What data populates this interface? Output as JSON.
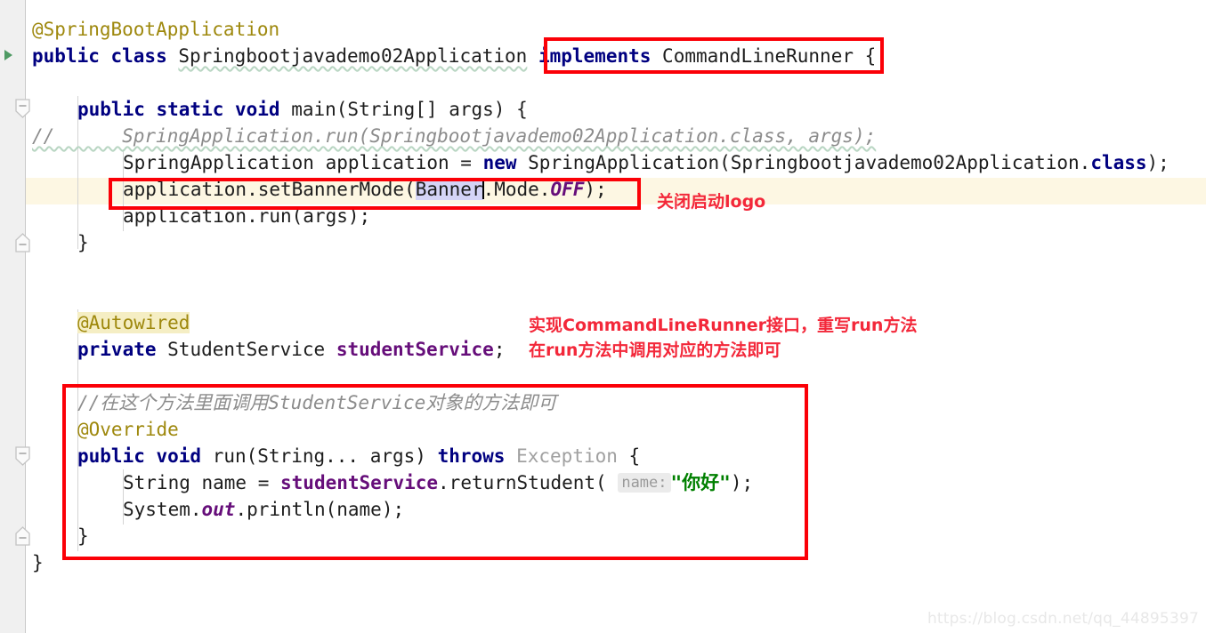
{
  "editor": {
    "kind": "intellij-java-editor",
    "language": "Java",
    "theme_background": "#ffffff",
    "current_line_highlight_color": "#fdf7e3",
    "selection_color": "#d4d4f7",
    "annotation_box_color": "#fb0007",
    "annotation_text_color": "#f3283a"
  },
  "code_lines": [
    {
      "n": 1,
      "indent": 0,
      "text": "@SpringBootApplication",
      "tokens": [
        {
          "t": "@SpringBootApplication",
          "c": "anno"
        }
      ]
    },
    {
      "n": 2,
      "indent": 0,
      "text": "public class Springbootjavademo02Application implements CommandLineRunner {",
      "tokens": [
        {
          "t": "public class ",
          "c": "kw"
        },
        {
          "t": "Springbootjavademo02Application",
          "c": "plain-underline"
        },
        {
          "t": " ",
          "c": "plain"
        },
        {
          "t": "implements ",
          "c": "kw"
        },
        {
          "t": "CommandLineRunner",
          "c": "plain"
        },
        {
          "t": " {",
          "c": "plain"
        }
      ]
    },
    {
      "n": 3,
      "indent": 1,
      "text": "public static void main(String[] args) {",
      "tokens": [
        {
          "t": "public static void ",
          "c": "kw"
        },
        {
          "t": "main(String[] args) {",
          "c": "plain"
        }
      ]
    },
    {
      "n": 4,
      "indent": 0,
      "text": "//      SpringApplication.run(Springbootjavademo02Application.class, args);",
      "tokens": [
        {
          "t": "//      SpringApplication.run(Springbootjavademo02Application.class, args);",
          "c": "comment"
        }
      ]
    },
    {
      "n": 5,
      "indent": 2,
      "text": "SpringApplication application = new SpringApplication(Springbootjavademo02Application.class);",
      "tokens": [
        {
          "t": "SpringApplication application = ",
          "c": "plain"
        },
        {
          "t": "new ",
          "c": "kw"
        },
        {
          "t": "SpringApplication(Springbootjavademo02Application.",
          "c": "plain"
        },
        {
          "t": "class",
          "c": "kw"
        },
        {
          "t": ");",
          "c": "plain"
        }
      ]
    },
    {
      "n": 6,
      "indent": 2,
      "text": "application.setBannerMode(Banner.Mode.OFF);",
      "selected_word": "Banner",
      "tokens": [
        {
          "t": "application.setBannerMode(",
          "c": "plain"
        },
        {
          "t": "Banner",
          "c": "sel"
        },
        {
          "t": ".Mode.",
          "c": "plain"
        },
        {
          "t": "OFF",
          "c": "statconst"
        },
        {
          "t": ");",
          "c": "plain"
        }
      ]
    },
    {
      "n": 7,
      "indent": 2,
      "text": "application.run(args);",
      "tokens": [
        {
          "t": "application.run(args);",
          "c": "plain"
        }
      ]
    },
    {
      "n": 8,
      "indent": 1,
      "text": "}",
      "tokens": [
        {
          "t": "}",
          "c": "plain"
        }
      ]
    },
    {
      "n": 9,
      "indent": 1,
      "text": "@Autowired",
      "tokens": [
        {
          "t": "@Autowired",
          "c": "anno-hl"
        }
      ]
    },
    {
      "n": 10,
      "indent": 1,
      "text": "private StudentService studentService;",
      "tokens": [
        {
          "t": "private ",
          "c": "kw"
        },
        {
          "t": "StudentService ",
          "c": "plain"
        },
        {
          "t": "studentService",
          "c": "field"
        },
        {
          "t": ";",
          "c": "plain"
        }
      ]
    },
    {
      "n": 11,
      "indent": 1,
      "text": "//在这个方法里面调用StudentService对象的方法即可",
      "tokens": [
        {
          "t": "//在这个方法里面调用StudentService对象的方法即可",
          "c": "comment"
        }
      ]
    },
    {
      "n": 12,
      "indent": 1,
      "text": "@Override",
      "tokens": [
        {
          "t": "@Override",
          "c": "anno"
        }
      ]
    },
    {
      "n": 13,
      "indent": 1,
      "text": "public void run(String... args) throws Exception {",
      "tokens": [
        {
          "t": "public void ",
          "c": "kw"
        },
        {
          "t": "run(String... args) ",
          "c": "plain"
        },
        {
          "t": "throws ",
          "c": "kw"
        },
        {
          "t": "Exception",
          "c": "grayed"
        },
        {
          "t": " {",
          "c": "plain"
        }
      ]
    },
    {
      "n": 14,
      "indent": 2,
      "text": "String name = studentService.returnStudent( name: \"你好\");",
      "param_hint": "name:",
      "tokens": [
        {
          "t": "String name = ",
          "c": "plain"
        },
        {
          "t": "studentService",
          "c": "field"
        },
        {
          "t": ".returnStudent( ",
          "c": "plain"
        },
        {
          "t": "name:",
          "c": "param-hint"
        },
        {
          "t": "\"你好\"",
          "c": "str"
        },
        {
          "t": ");",
          "c": "plain"
        }
      ]
    },
    {
      "n": 15,
      "indent": 2,
      "text": "System.out.println(name);",
      "tokens": [
        {
          "t": "System.",
          "c": "plain"
        },
        {
          "t": "out",
          "c": "statfield"
        },
        {
          "t": ".println(name);",
          "c": "plain"
        }
      ]
    },
    {
      "n": 16,
      "indent": 1,
      "text": "}",
      "tokens": [
        {
          "t": "}",
          "c": "plain"
        }
      ]
    },
    {
      "n": 17,
      "indent": 0,
      "text": "}",
      "tokens": [
        {
          "t": "}",
          "c": "plain"
        }
      ]
    }
  ],
  "lines_render": {
    "l1": "@SpringBootApplication",
    "l2_a": "public class ",
    "l2_b": "Springbootjavademo02Application",
    "l2_c": "implements ",
    "l2_d": "CommandLineRunner",
    "l2_e": " {",
    "l3_a": "public static void ",
    "l3_b": "main(String[] args) {",
    "l4": "//      SpringApplication.run(Springbootjavademo02Application.class, args);",
    "l5_a": "SpringApplication application = ",
    "l5_b": "new ",
    "l5_c": "SpringApplication(Springbootjavademo02Application.",
    "l5_d": "class",
    "l5_e": ");",
    "l6_a": "application.setBannerMode(",
    "l6_b": "Banner",
    "l6_c": ".Mode.",
    "l6_d": "OFF",
    "l6_e": ");",
    "l7": "application.run(args);",
    "l8": "}",
    "l9": "@Autowired",
    "l10_a": "private ",
    "l10_b": "StudentService ",
    "l10_c": "studentService",
    "l10_d": ";",
    "l11": "//在这个方法里面调用StudentService对象的方法即可",
    "l12": "@Override",
    "l13_a": "public void ",
    "l13_b": "run(String... args) ",
    "l13_c": "throws ",
    "l13_d": "Exception",
    "l13_e": " {",
    "l14_a": "String name = ",
    "l14_b": "studentService",
    "l14_c": ".returnStudent( ",
    "l14_d": "name:",
    "l14_e": "\"你好\"",
    "l14_f": ");",
    "l15_a": "System.",
    "l15_b": "out",
    "l15_c": ".println(name);",
    "l16": "}",
    "l17": "}"
  },
  "annotations": {
    "note_banner": "关闭启动logo",
    "note_runner_line1": "实现CommandLineRunner接口，重写run方法",
    "note_runner_line2": "在run方法中调用对应的方法即可",
    "boxes": [
      {
        "name": "implements-clause-box",
        "label": "implements CommandLineRunner"
      },
      {
        "name": "set-banner-mode-box",
        "label": "application.setBannerMode(Banner.Mode.OFF);"
      },
      {
        "name": "run-method-box",
        "label": "run method implementation block"
      }
    ]
  },
  "gutter": {
    "run_icon_tooltip": "Run",
    "fold_markers": 4
  },
  "watermark": "https://blog.csdn.net/qq_44895397"
}
